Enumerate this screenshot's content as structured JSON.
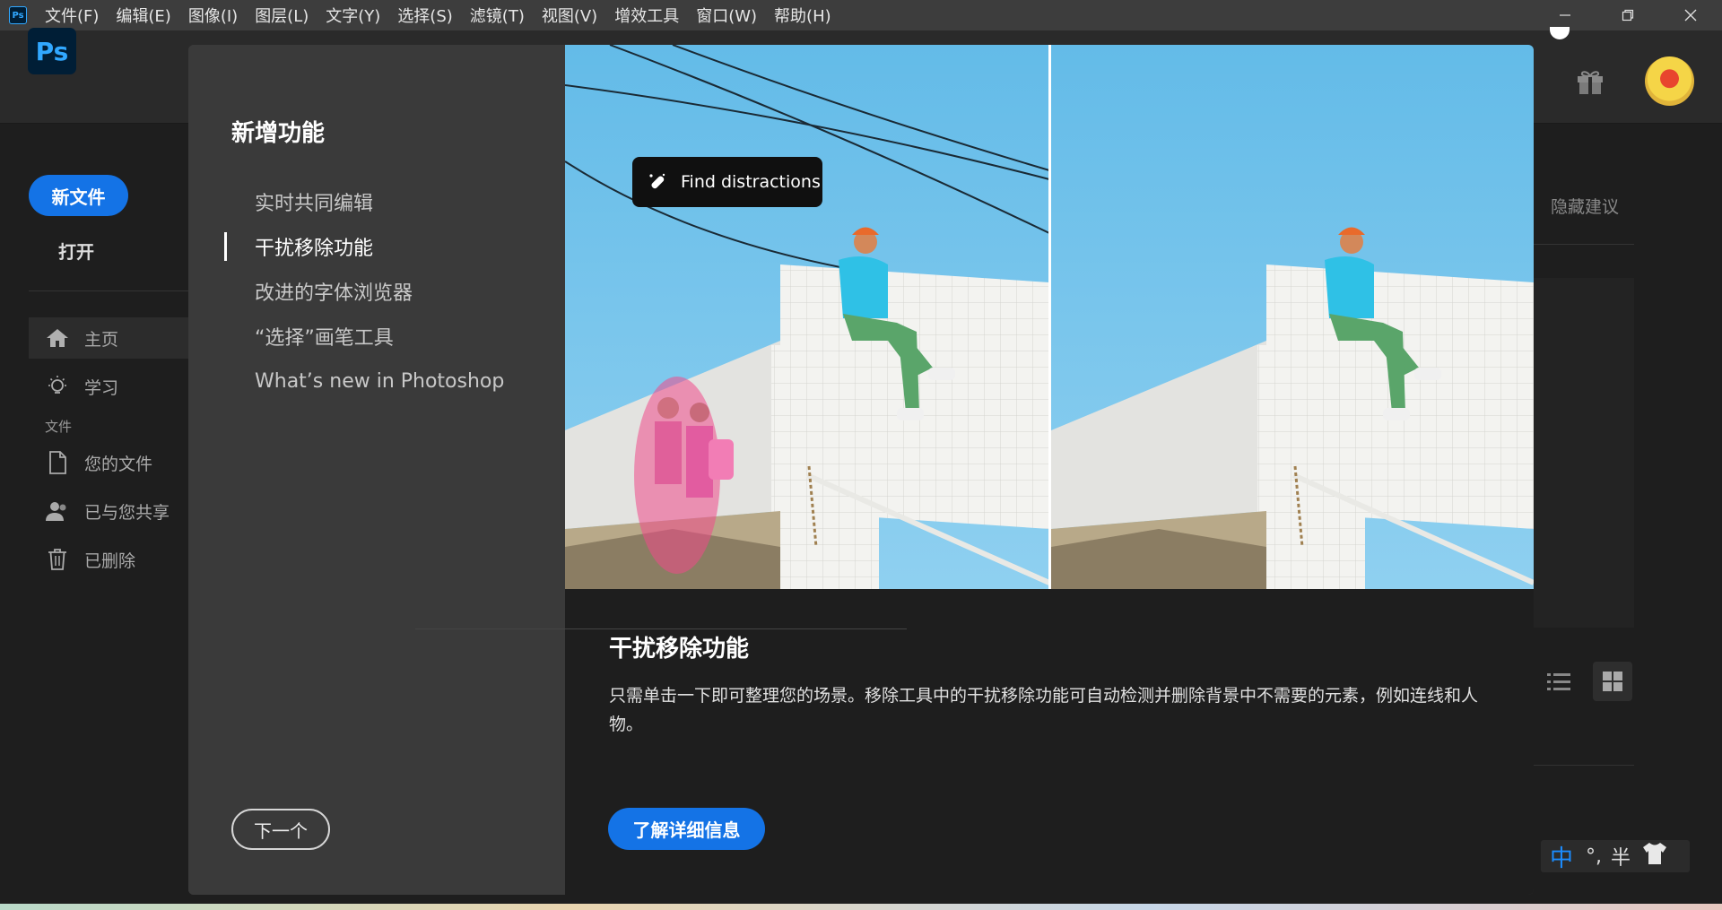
{
  "menubar": {
    "app_icon": "Ps",
    "items": [
      "文件(F)",
      "编辑(E)",
      "图像(I)",
      "图层(L)",
      "文字(Y)",
      "选择(S)",
      "滤镜(T)",
      "视图(V)",
      "增效工具",
      "窗口(W)",
      "帮助(H)"
    ],
    "window_controls": [
      "minimize-icon",
      "restore-icon",
      "close-icon"
    ]
  },
  "app": {
    "logo": "Ps",
    "new_file": "新文件",
    "open": "打开",
    "nav": [
      {
        "label": "主页",
        "icon": "home-icon"
      },
      {
        "label": "学习",
        "icon": "lightbulb-icon"
      }
    ],
    "files_section": "文件",
    "files_nav": [
      {
        "label": "您的文件",
        "icon": "document-icon"
      },
      {
        "label": "已与您共享",
        "icon": "shared-users-icon"
      },
      {
        "label": "已删除",
        "icon": "trash-icon"
      }
    ],
    "hide_suggestions": "隐藏建议"
  },
  "dialog": {
    "title": "新增功能",
    "features": [
      "实时共同编辑",
      "干扰移除功能",
      "改进的字体浏览器",
      "“选择”画笔工具",
      "What’s new in Photoshop"
    ],
    "active_index": 1,
    "next_button": "下一个",
    "hero_pill": "Find distractions",
    "feature_title": "干扰移除功能",
    "feature_description": "只需单击一下即可整理您的场景。移除工具中的干扰移除功能可自动检测并删除背景中不需要的元素，例如连线和人物。",
    "learn_more": "了解详细信息"
  },
  "ime": {
    "mode": "中",
    "punct": "°,",
    "width": "半"
  },
  "colors": {
    "accent": "#1473e6",
    "sky": "#6ec1ea",
    "wall": "#f1f1ee",
    "menubar": "#3d3d3d"
  }
}
